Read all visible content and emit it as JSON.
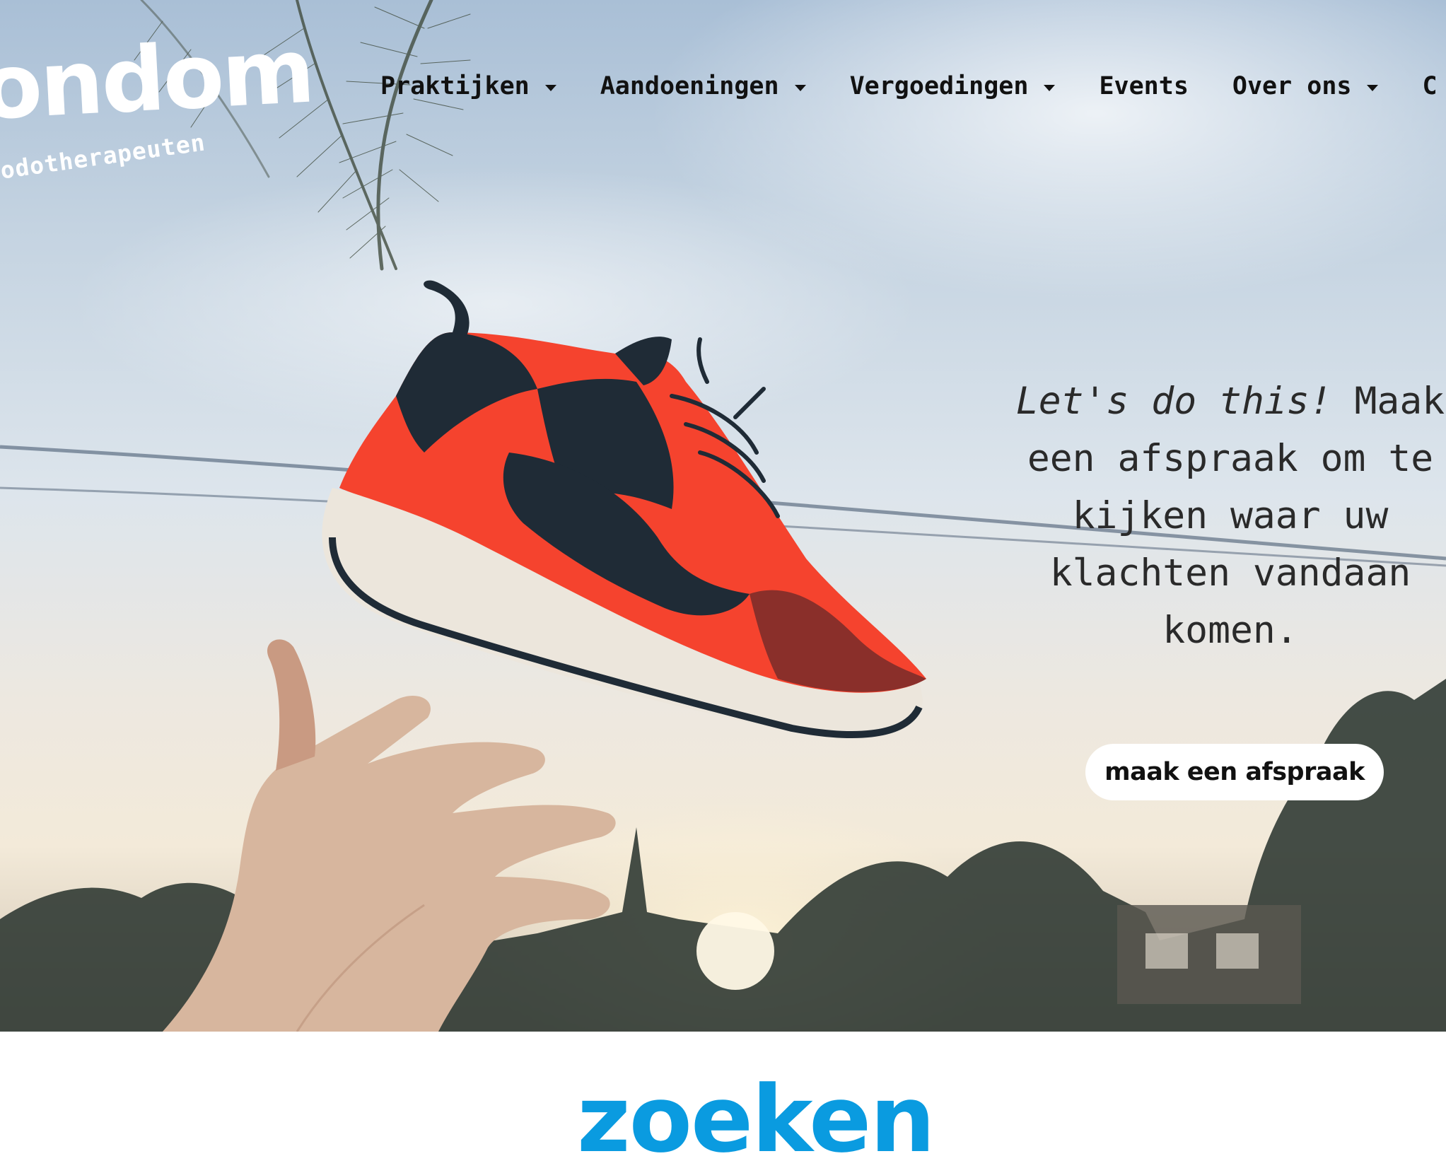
{
  "logo": {
    "wordmark": "ondom",
    "subtitle": "odotherapeuten"
  },
  "nav": {
    "items": [
      {
        "label": "Praktijken",
        "has_dropdown": true
      },
      {
        "label": "Aandoeningen",
        "has_dropdown": true
      },
      {
        "label": "Vergoedingen",
        "has_dropdown": true
      },
      {
        "label": "Events",
        "has_dropdown": false
      },
      {
        "label": "Over ons",
        "has_dropdown": true
      }
    ],
    "overflow_char": "C"
  },
  "hero": {
    "tagline_emphasis": "Let's do this!",
    "tagline_line1_rest": " Maak",
    "tagline_line2": "een afspraak om te",
    "tagline_line3": "kijken waar uw",
    "tagline_line4": "klachten vandaan",
    "tagline_line5": "komen.",
    "cta_label": "maak een afspraak"
  },
  "search_section": {
    "heading": "zoeken"
  },
  "colors": {
    "accent_blue": "#0a9be0",
    "shoe_red": "#f5432e",
    "shoe_dark": "#1f2b36"
  }
}
